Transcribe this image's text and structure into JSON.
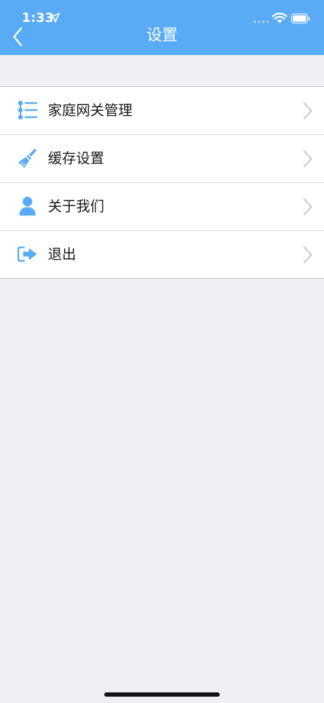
{
  "status_bar": {
    "time": "1:33"
  },
  "nav": {
    "title": "设置"
  },
  "menu": [
    {
      "label": "家庭网关管理",
      "icon": "list-icon"
    },
    {
      "label": "缓存设置",
      "icon": "brush-icon"
    },
    {
      "label": "关于我们",
      "icon": "person-icon"
    },
    {
      "label": "退出",
      "icon": "logout-icon"
    }
  ],
  "colors": {
    "accent": "#5aabf5",
    "icon": "#5aabf5",
    "background": "#efeff4"
  }
}
